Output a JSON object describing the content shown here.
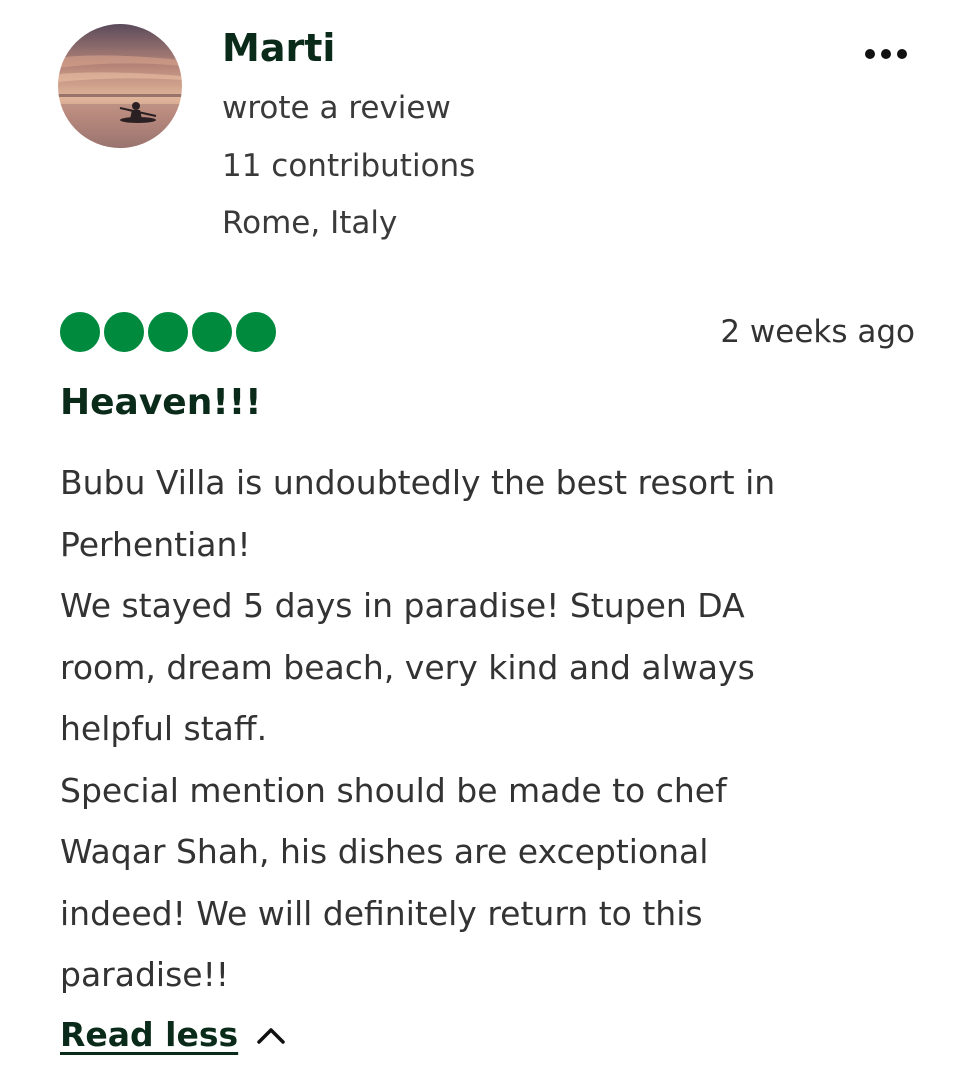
{
  "reviewer": {
    "name": "Marti",
    "action": "wrote a review",
    "contributions": "11 contributions",
    "location": "Rome, Italy",
    "avatar_icon": "kayak-sunset-photo"
  },
  "menu": {
    "icon": "more-options-icon"
  },
  "review": {
    "rating": 5,
    "rating_max": 5,
    "rating_color": "#008a3e",
    "date": "2 weeks ago",
    "title": "Heaven!!!",
    "body_lines": [
      "Bubu Villa is undoubtedly the best resort in",
      "Perhentian!",
      "We stayed 5 days in paradise! Stupen DA",
      "room, dream beach, very kind and always",
      "helpful staff.",
      "Special mention should be made to chef",
      "Waqar Shah, his dishes are exceptional",
      "indeed! We will definitely return to this",
      "paradise!!"
    ]
  },
  "actions": {
    "read_less_label": "Read less",
    "read_less_icon": "chevron-up-icon"
  }
}
